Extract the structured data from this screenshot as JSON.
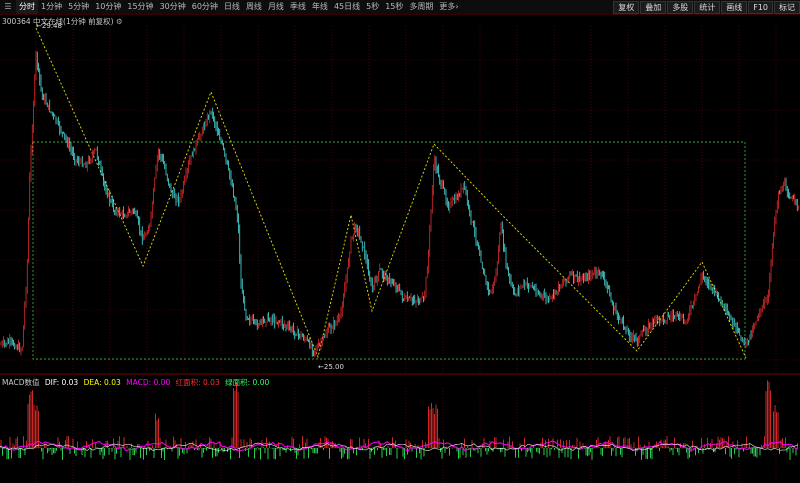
{
  "toolbar": {
    "left_items": [
      {
        "label": "分时"
      },
      {
        "label": "1分钟"
      },
      {
        "label": "5分钟"
      },
      {
        "label": "10分钟"
      },
      {
        "label": "15分钟"
      },
      {
        "label": "30分钟"
      },
      {
        "label": "60分钟"
      },
      {
        "label": "日线"
      },
      {
        "label": "周线"
      },
      {
        "label": "月线"
      },
      {
        "label": "季线"
      },
      {
        "label": "年线"
      },
      {
        "label": "45日线"
      },
      {
        "label": "5秒"
      },
      {
        "label": "15秒"
      },
      {
        "label": "多周期"
      },
      {
        "label": "更多"
      }
    ],
    "right_items": [
      {
        "label": "复权"
      },
      {
        "label": "叠加"
      },
      {
        "label": "多股"
      },
      {
        "label": "统计"
      },
      {
        "label": "画线"
      },
      {
        "label": "F10"
      },
      {
        "label": "标记"
      }
    ],
    "menu_icon": "menu-icon",
    "more_icon": "chevron-right-icon"
  },
  "header": {
    "code": "300364",
    "name": "中文在线(1分钟 前复权)",
    "gear_icon": "gear-icon"
  },
  "price_labels": {
    "high": "29.48",
    "low": "25.00"
  },
  "macd": {
    "title": "MACD数值",
    "dif": "DIF: 0.03",
    "dea": "DEA: 0.03",
    "macd": "MACD: 0.00",
    "red_area": "红面积: 0.03",
    "green_area": "绿面积: 0.00",
    "colors": {
      "title": "#c8c8c8",
      "dif": "#ffffff",
      "dea": "#ffff00",
      "macd": "#ff00ff",
      "red_area": "#ff3030",
      "green_area": "#33ff66"
    }
  },
  "colors": {
    "background": "#000000",
    "up": "#ff3232",
    "down": "#54ffff",
    "grid": "#7a0000",
    "zigzag": "#e6e600",
    "box": "#33aa33"
  }
}
